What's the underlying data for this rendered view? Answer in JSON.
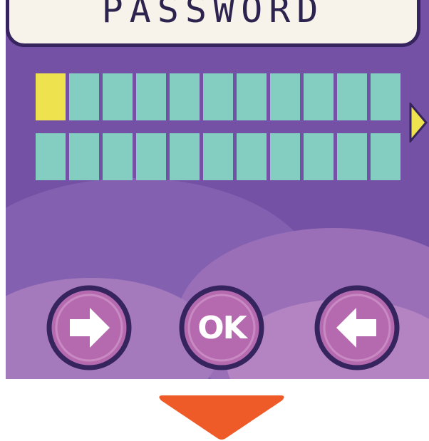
{
  "title": "PASSWORD",
  "password_entry": {
    "row_count": 2,
    "slots_per_row": 11,
    "active_slot": 0
  },
  "buttons": {
    "ok_label": "OK",
    "right_arrow_icon": "arrow-right-icon",
    "left_arrow_icon": "arrow-left-icon",
    "next_icon": "triangle-right-icon",
    "down_icon": "triangle-down-icon"
  },
  "colors": {
    "background": "#7451a5",
    "panel": "#f8f3ea",
    "outline": "#36245f",
    "slot": "#84cdc1",
    "slot_active": "#eee34f",
    "button": "#b56ab0",
    "down_arrow": "#ef5a29"
  }
}
